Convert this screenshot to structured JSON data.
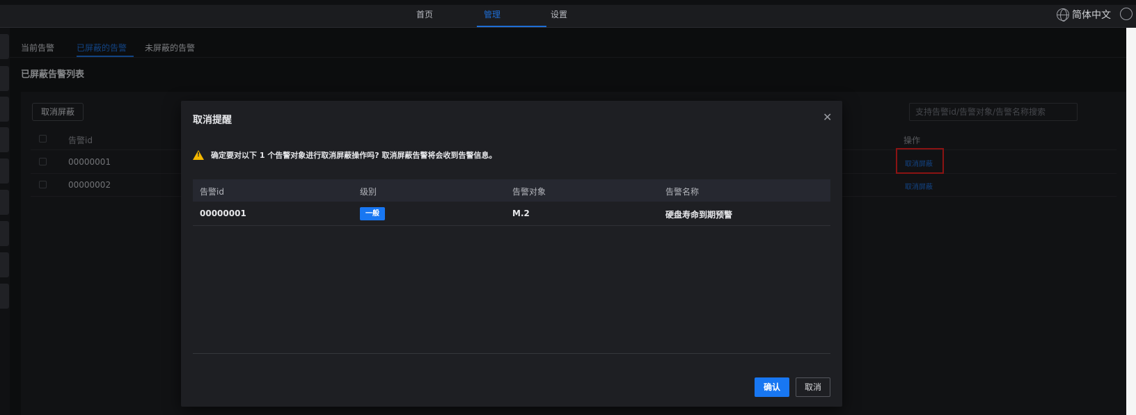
{
  "topnav": {
    "items": [
      {
        "label": "首页",
        "active": false
      },
      {
        "label": "管理",
        "active": true
      },
      {
        "label": "设置",
        "active": false
      }
    ],
    "language": "简体中文"
  },
  "subtabs": [
    {
      "label": "当前告警",
      "active": false
    },
    {
      "label": "已屏蔽的告警",
      "active": true
    },
    {
      "label": "未屏蔽的告警",
      "active": false
    }
  ],
  "section_title": "已屏蔽告警列表",
  "toolbar": {
    "unmask_button": "取消屏蔽",
    "search_placeholder": "支持告警id/告警对象/告警名称搜索"
  },
  "table": {
    "columns": [
      "告警id",
      "操作"
    ],
    "rows": [
      {
        "id": "00000001",
        "action": "取消屏蔽"
      },
      {
        "id": "00000002",
        "action": "取消屏蔽"
      }
    ]
  },
  "modal": {
    "title": "取消提醒",
    "warning": "确定要对以下 1 个告警对象进行取消屏蔽操作吗? 取消屏蔽告警将会收到告警信息。",
    "columns": [
      "告警id",
      "级别",
      "告警对象",
      "告警名称"
    ],
    "rows": [
      {
        "id": "00000001",
        "level": "一般",
        "object": "M.2",
        "name": "硬盘寿命到期预警"
      }
    ],
    "confirm": "确认",
    "cancel": "取消"
  },
  "colors": {
    "accent": "#1e6ed6",
    "primary_button": "#1877f2",
    "warning": "#f5b800",
    "highlight": "#e02020"
  }
}
